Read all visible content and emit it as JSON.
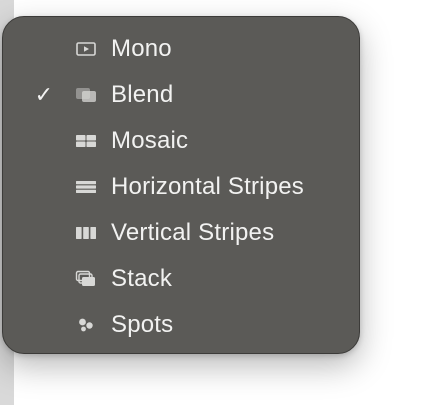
{
  "menu": {
    "items": [
      {
        "label": "Mono",
        "icon": "play-rectangle-icon",
        "checked": false
      },
      {
        "label": "Blend",
        "icon": "blend-icon",
        "checked": true
      },
      {
        "label": "Mosaic",
        "icon": "mosaic-grid-icon",
        "checked": false
      },
      {
        "label": "Horizontal Stripes",
        "icon": "horizontal-stripes-icon",
        "checked": false
      },
      {
        "label": "Vertical Stripes",
        "icon": "vertical-stripes-icon",
        "checked": false
      },
      {
        "label": "Stack",
        "icon": "stack-icon",
        "checked": false
      },
      {
        "label": "Spots",
        "icon": "spots-icon",
        "checked": false
      }
    ],
    "check_glyph": "✓",
    "colors": {
      "background": "#5b5a57",
      "text": "#f2f2f1",
      "icon": "#d8d8d6"
    }
  }
}
